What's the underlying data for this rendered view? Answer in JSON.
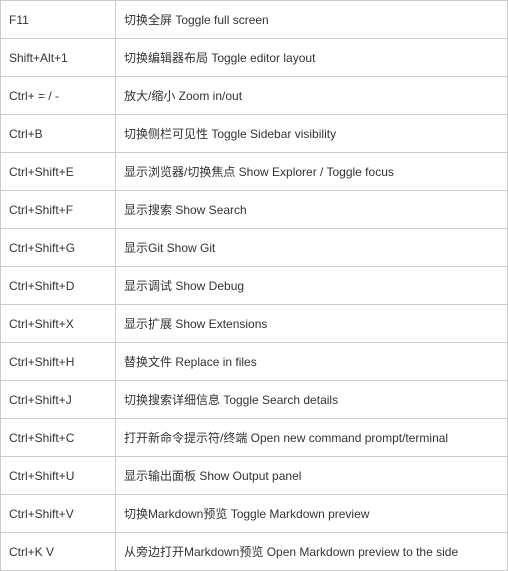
{
  "rows": [
    {
      "shortcut": "F11",
      "desc": "切换全屏 Toggle full screen"
    },
    {
      "shortcut": "Shift+Alt+1",
      "desc": "切换编辑器布局 Toggle editor layout"
    },
    {
      "shortcut": "Ctrl+ = / -",
      "desc": "放大/缩小 Zoom in/out"
    },
    {
      "shortcut": "Ctrl+B",
      "desc": "切换侧栏可见性 Toggle Sidebar visibility"
    },
    {
      "shortcut": "Ctrl+Shift+E",
      "desc": "显示浏览器/切换焦点 Show Explorer / Toggle focus"
    },
    {
      "shortcut": "Ctrl+Shift+F",
      "desc": "显示搜索 Show Search"
    },
    {
      "shortcut": "Ctrl+Shift+G",
      "desc": "显示Git Show Git"
    },
    {
      "shortcut": "Ctrl+Shift+D",
      "desc": "显示调试 Show Debug"
    },
    {
      "shortcut": "Ctrl+Shift+X",
      "desc": "显示扩展 Show Extensions"
    },
    {
      "shortcut": "Ctrl+Shift+H",
      "desc": "替换文件 Replace in files"
    },
    {
      "shortcut": "Ctrl+Shift+J",
      "desc": "切换搜索详细信息 Toggle Search details"
    },
    {
      "shortcut": "Ctrl+Shift+C",
      "desc": "打开新命令提示符/终端 Open new command prompt/terminal"
    },
    {
      "shortcut": "Ctrl+Shift+U",
      "desc": "显示输出面板 Show Output panel"
    },
    {
      "shortcut": "Ctrl+Shift+V",
      "desc": "切换Markdown预览 Toggle Markdown preview"
    },
    {
      "shortcut": "Ctrl+K V",
      "desc": "从旁边打开Markdown预览 Open Markdown preview to the side"
    }
  ]
}
